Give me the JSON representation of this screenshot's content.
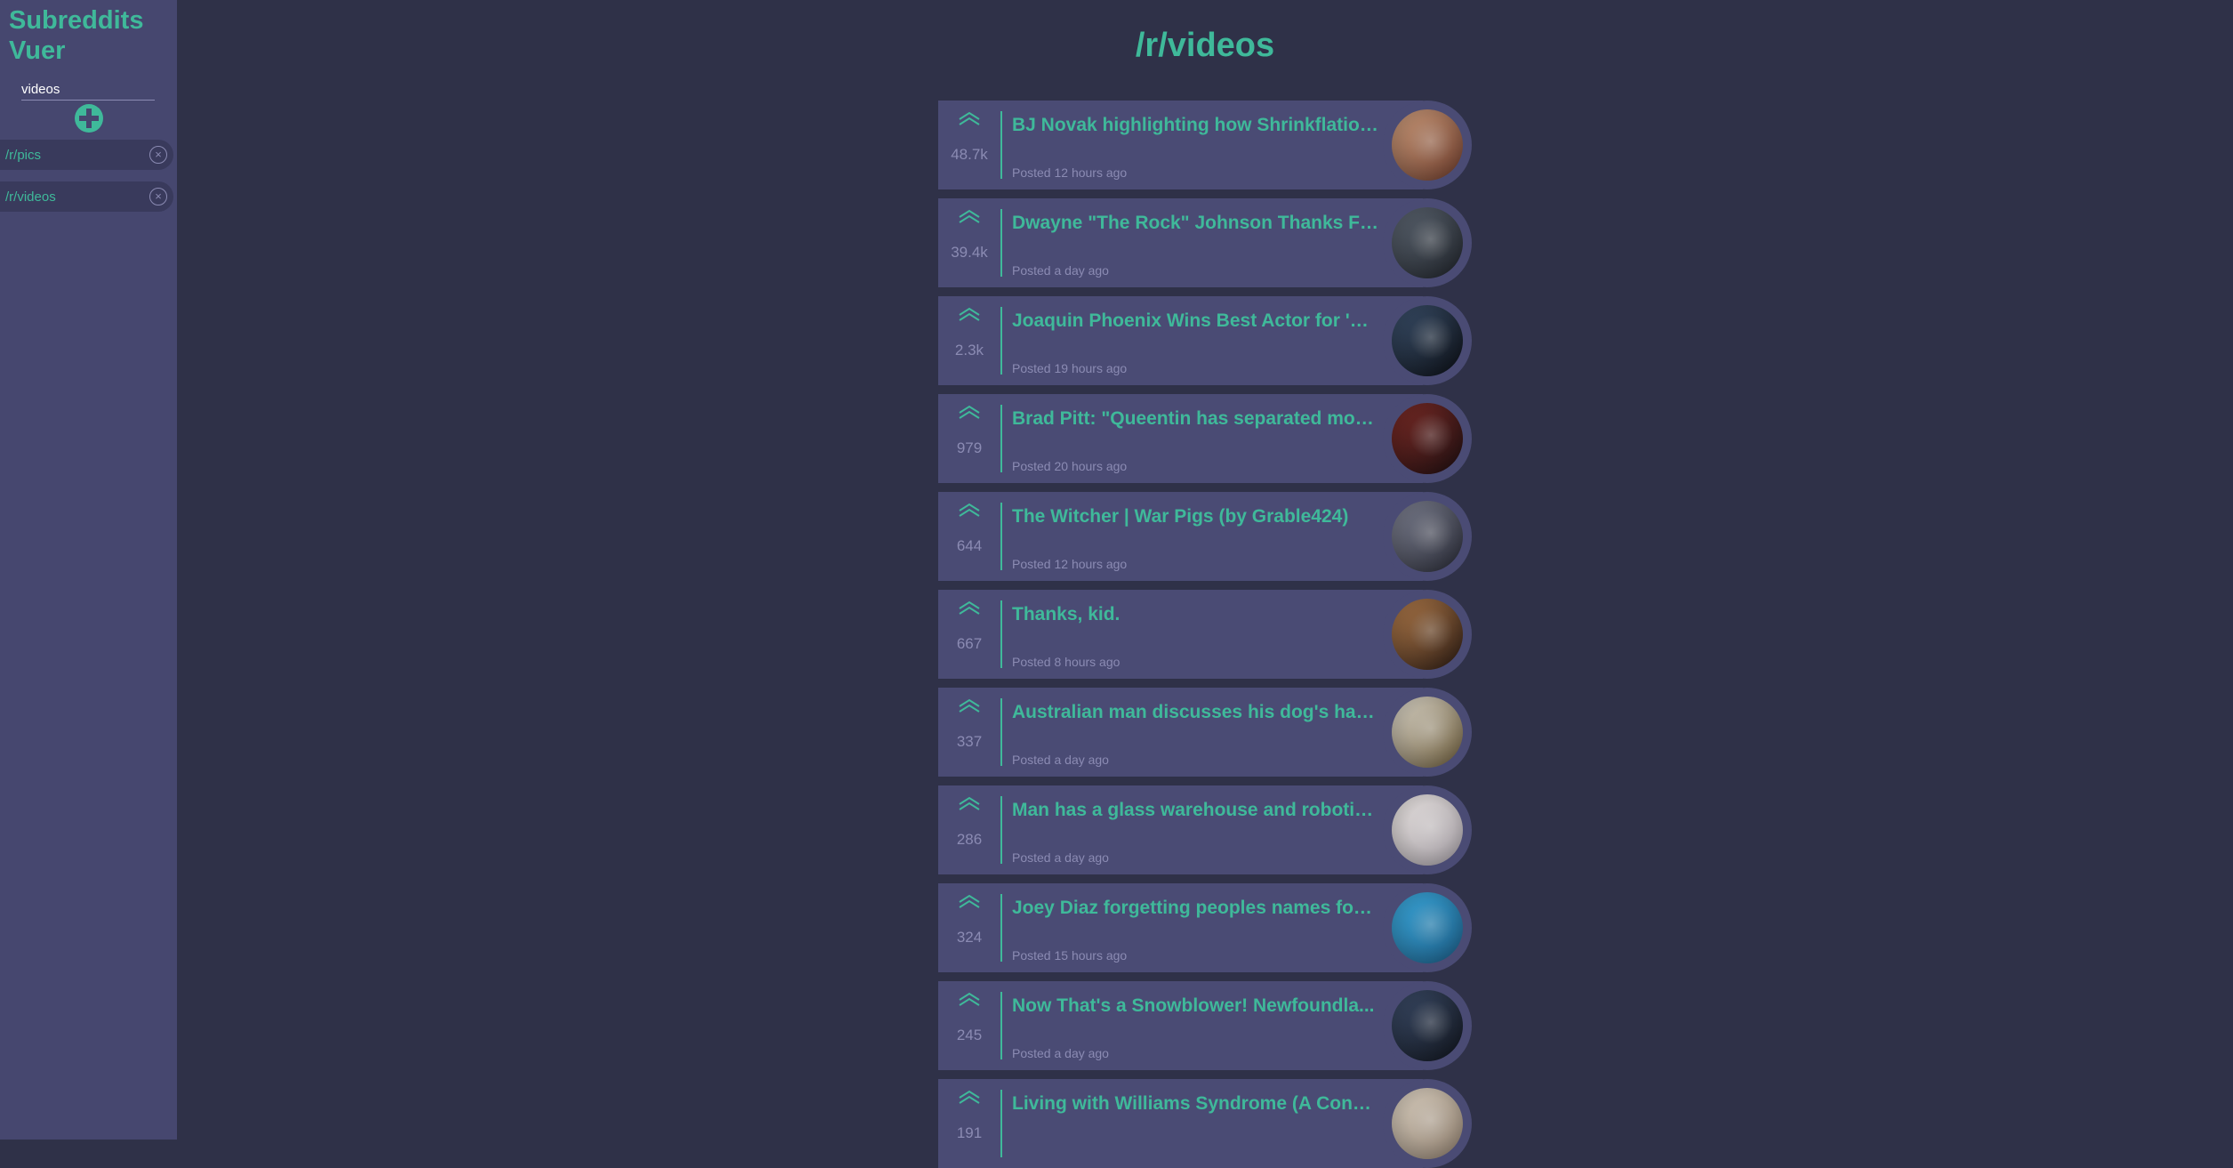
{
  "sidebar": {
    "title": "Subreddits Vuer",
    "input_value": "videos",
    "add_icon": "plus-circle-icon",
    "items": [
      {
        "label": "/r/pics",
        "close_glyph": "×"
      },
      {
        "label": "/r/videos",
        "close_glyph": "×"
      }
    ]
  },
  "main": {
    "title": "/r/videos",
    "posts": [
      {
        "title": "BJ Novak highlighting how Shrinkflation is destroying the candy industry",
        "score": "48.7k",
        "meta": "Posted 12 hours ago",
        "thumb_colors": [
          "#c99a7a",
          "#6a3a2a"
        ]
      },
      {
        "title": "Dwayne \"The Rock\" Johnson Thanks Fans",
        "score": "39.4k",
        "meta": "Posted a day ago",
        "thumb_colors": [
          "#5b6470",
          "#1e2228"
        ]
      },
      {
        "title": "Joaquin Phoenix Wins Best Actor for 'Joker'",
        "score": "2.3k",
        "meta": "Posted 19 hours ago",
        "thumb_colors": [
          "#3a4f6a",
          "#0b0e14"
        ]
      },
      {
        "title": "Brad Pitt: \"Queentin has separated more...",
        "score": "979",
        "meta": "Posted 20 hours ago",
        "thumb_colors": [
          "#7a2a25",
          "#1c0e10"
        ]
      },
      {
        "title": "The Witcher | War Pigs (by Grable424)",
        "score": "644",
        "meta": "Posted 12 hours ago",
        "thumb_colors": [
          "#7d8090",
          "#262833"
        ]
      },
      {
        "title": "Thanks, kid.",
        "score": "667",
        "meta": "Posted 8 hours ago",
        "thumb_colors": [
          "#b07a4a",
          "#2a1a12"
        ]
      },
      {
        "title": "Australian man discusses his dog's hall...",
        "score": "337",
        "meta": "Posted a day ago",
        "thumb_colors": [
          "#d9d4c8",
          "#6a5a3a"
        ]
      },
      {
        "title": "Man has a glass warehouse and robotic...",
        "score": "286",
        "meta": "Posted a day ago",
        "thumb_colors": [
          "#e7e2e0",
          "#a09aa0"
        ]
      },
      {
        "title": "Joey Diaz forgetting peoples names for ...",
        "score": "324",
        "meta": "Posted 15 hours ago",
        "thumb_colors": [
          "#3aa6d9",
          "#1b5a82"
        ]
      },
      {
        "title": "Now That's a Snowblower! Newfoundla...",
        "score": "245",
        "meta": "Posted a day ago",
        "thumb_colors": [
          "#3a4a66",
          "#10141c"
        ]
      },
      {
        "title": "Living with Williams Syndrome (A Cond...",
        "score": "191",
        "meta": "",
        "thumb_colors": [
          "#d9cfc0",
          "#8a7a6a"
        ]
      }
    ]
  }
}
